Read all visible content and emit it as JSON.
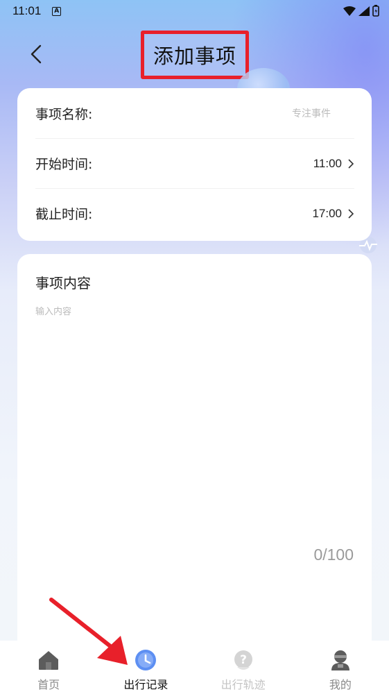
{
  "status_bar": {
    "time": "11:01",
    "app_indicator": "A"
  },
  "header": {
    "title": "添加事项"
  },
  "form": {
    "name": {
      "label": "事项名称:",
      "placeholder": "专注事件"
    },
    "start_time": {
      "label": "开始时间:",
      "value": "11:00"
    },
    "end_time": {
      "label": "截止时间:",
      "value": "17:00"
    }
  },
  "content": {
    "title": "事项内容",
    "placeholder": "输入内容",
    "counter": "0/100"
  },
  "tabbar": {
    "items": [
      {
        "label": "首页",
        "icon": "home-icon"
      },
      {
        "label": "出行记录",
        "icon": "clock-icon"
      },
      {
        "label": "出行轨迹",
        "icon": "question-icon"
      },
      {
        "label": "我的",
        "icon": "user-icon"
      }
    ],
    "active_index": 1
  },
  "colors": {
    "highlight_box": "#e8202a",
    "active_tab_icon": "#5d8ff2"
  }
}
